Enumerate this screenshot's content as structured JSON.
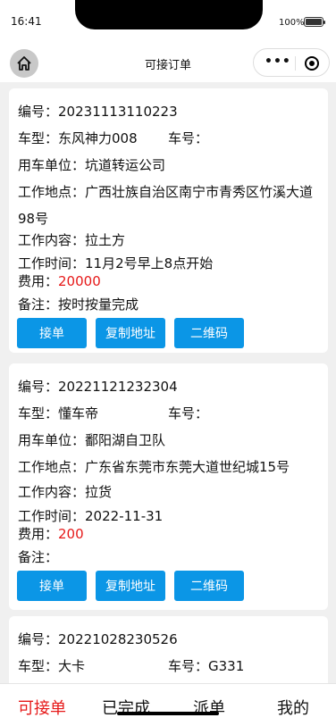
{
  "status": {
    "time": "16:41",
    "battery": "100%"
  },
  "nav": {
    "title": "可接订单"
  },
  "labels": {
    "no": "编号：",
    "car_type": "车型：",
    "plate": "车号：",
    "unit": "用车单位：",
    "place": "工作地点：",
    "content": "工作内容：",
    "time": "工作时间：",
    "fee": "费用：",
    "note": "备注："
  },
  "buttons": {
    "accept": "接单",
    "copy": "复制地址",
    "qrcode": "二维码"
  },
  "orders": [
    {
      "no": "20231113110223",
      "car_type": "东风神力008",
      "plate": "",
      "unit": "坑道转运公司",
      "place": "广西壮族自治区南宁市青秀区竹溪大道98号",
      "content": "拉土方",
      "time": "11月2号早上8点开始",
      "fee": "20000",
      "note": "按时按量完成"
    },
    {
      "no": "20221121232304",
      "car_type": "懂车帝",
      "plate": "",
      "unit": "鄱阳湖自卫队",
      "place": "广东省东莞市东莞大道世纪城15号",
      "content": "拉货",
      "time": "2022-11-31",
      "fee": "200",
      "note": ""
    },
    {
      "no": "20221028230526",
      "car_type": "大卡",
      "plate": "G331"
    }
  ],
  "tabs": [
    "可接单",
    "已完成",
    "派单",
    "我的"
  ],
  "colors": {
    "accent": "#e61919",
    "button": "#0b96e6"
  }
}
